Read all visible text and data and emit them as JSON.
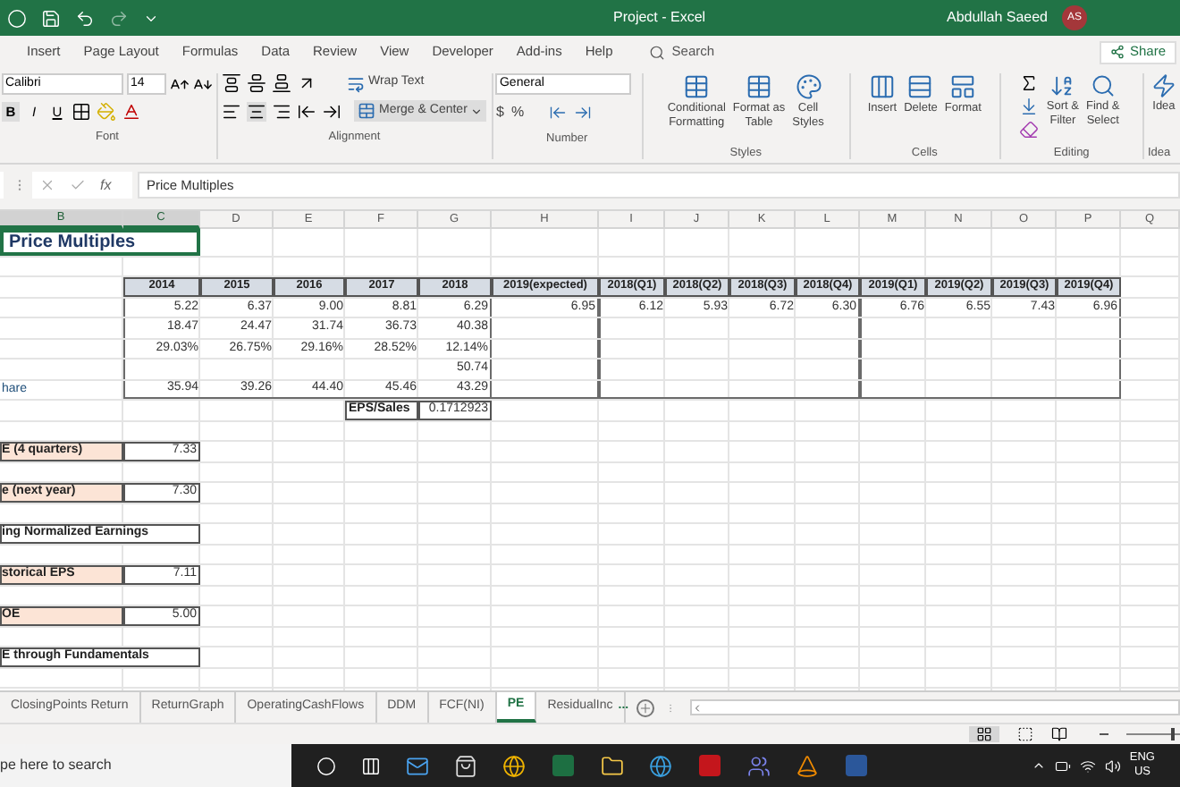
{
  "window": {
    "title": "Project - Excel",
    "user": "Abdullah Saeed",
    "avatar": "AS"
  },
  "menu_tabs": [
    {
      "label": "Insert",
      "selected": false
    },
    {
      "label": "Page Layout",
      "selected": false
    },
    {
      "label": "Formulas",
      "selected": false
    },
    {
      "label": "Data",
      "selected": false
    },
    {
      "label": "Review",
      "selected": false
    },
    {
      "label": "View",
      "selected": false
    },
    {
      "label": "Developer",
      "selected": false
    },
    {
      "label": "Add-ins",
      "selected": false
    },
    {
      "label": "Help",
      "selected": false
    }
  ],
  "search": {
    "placeholder": "Search"
  },
  "share": "Share",
  "ribbon": {
    "font": {
      "name": "Calibri",
      "size": "14",
      "style_buttons": [
        "B",
        "I",
        "U"
      ],
      "label": "Font"
    },
    "alignment": {
      "wrap": "Wrap Text",
      "merge": "Merge & Center",
      "label": "Alignment"
    },
    "number": {
      "format": "General",
      "symbols": [
        "$",
        "%"
      ],
      "label": "Number"
    },
    "styles": {
      "buttons": [
        {
          "lines": [
            "Conditional",
            "Formatting"
          ]
        },
        {
          "lines": [
            "Format as",
            "Table"
          ]
        },
        {
          "lines": [
            "Cell",
            "Styles"
          ]
        }
      ],
      "label": "Styles"
    },
    "cells": {
      "buttons": [
        "Insert",
        "Delete",
        "Format"
      ],
      "label": "Cells"
    },
    "editing": {
      "buttons": [
        {
          "lines": [
            "Sort &",
            "Filter"
          ]
        },
        {
          "lines": [
            "Find &",
            "Select"
          ]
        }
      ],
      "label": "Editing"
    },
    "ideas": {
      "button": "Idea",
      "label": "Idea"
    }
  },
  "formula_bar": {
    "fx": "fx",
    "content": "Price Multiples"
  },
  "sheet": {
    "columns": [
      {
        "letter": "B",
        "selected": true
      },
      {
        "letter": "C",
        "selected": true
      },
      {
        "letter": "D",
        "selected": false
      },
      {
        "letter": "E",
        "selected": false
      },
      {
        "letter": "F",
        "selected": false
      },
      {
        "letter": "G",
        "selected": false
      },
      {
        "letter": "H",
        "selected": false
      },
      {
        "letter": "I",
        "selected": false
      },
      {
        "letter": "J",
        "selected": false
      },
      {
        "letter": "K",
        "selected": false
      },
      {
        "letter": "L",
        "selected": false
      },
      {
        "letter": "M",
        "selected": false
      },
      {
        "letter": "N",
        "selected": false
      },
      {
        "letter": "O",
        "selected": false
      },
      {
        "letter": "P",
        "selected": false
      },
      {
        "letter": "Q",
        "selected": false
      }
    ],
    "rows": [
      {
        "kind": "title",
        "cells": {
          "B": "Price Multiples"
        }
      },
      {
        "kind": "blank"
      },
      {
        "kind": "header",
        "cells": {
          "C": "2014",
          "D": "2015",
          "E": "2016",
          "F": "2017",
          "G": "2018",
          "H": "2019(expected)",
          "I": "2018(Q1)",
          "J": "2018(Q2)",
          "K": "2018(Q3)",
          "L": "2018(Q4)",
          "M": "2019(Q1)",
          "N": "2019(Q2)",
          "O": "2019(Q3)",
          "P": "2019(Q4)"
        }
      },
      {
        "kind": "data",
        "cells": {
          "C": "5.22",
          "D": "6.37",
          "E": "9.00",
          "F": "8.81",
          "G": "6.29",
          "H": "6.95",
          "I": "6.12",
          "J": "5.93",
          "K": "6.72",
          "L": "6.30",
          "M": "6.76",
          "N": "6.55",
          "O": "7.43",
          "P": "6.96"
        }
      },
      {
        "kind": "data",
        "cells": {
          "C": "18.47",
          "D": "24.47",
          "E": "31.74",
          "F": "36.73",
          "G": "40.38"
        }
      },
      {
        "kind": "data",
        "cells": {
          "C": "29.03%",
          "D": "26.75%",
          "E": "29.16%",
          "F": "28.52%",
          "G": "12.14%"
        }
      },
      {
        "kind": "data",
        "cells": {
          "G": "50.74"
        }
      },
      {
        "kind": "data",
        "cells": {
          "B": "hare",
          "C": "35.94",
          "D": "39.26",
          "E": "44.40",
          "F": "45.46",
          "G": "43.29"
        }
      },
      {
        "kind": "note",
        "cells": {
          "F": "EPS/Sales",
          "G": "0.1712923"
        }
      },
      {
        "kind": "blank"
      },
      {
        "kind": "label",
        "cells": {
          "B": "E (4 quarters)",
          "C": "7.33"
        }
      },
      {
        "kind": "blank"
      },
      {
        "kind": "label",
        "cells": {
          "B": "e (next year)",
          "C": "7.30"
        }
      },
      {
        "kind": "blank"
      },
      {
        "kind": "section",
        "cells": {
          "B": "ing Normalized Earnings"
        }
      },
      {
        "kind": "blank"
      },
      {
        "kind": "label",
        "cells": {
          "B": "storical EPS",
          "C": "7.11"
        }
      },
      {
        "kind": "blank"
      },
      {
        "kind": "label",
        "cells": {
          "B": "OE",
          "C": "5.00"
        }
      },
      {
        "kind": "blank"
      },
      {
        "kind": "section",
        "cells": {
          "B": "E through Fundamentals"
        }
      },
      {
        "kind": "blank"
      }
    ]
  },
  "sheet_tabs": [
    {
      "label": "ClosingPoints Return",
      "selected": false
    },
    {
      "label": "ReturnGraph",
      "selected": false
    },
    {
      "label": "OperatingCashFlows",
      "selected": false
    },
    {
      "label": "DDM",
      "selected": false
    },
    {
      "label": "FCF(NI)",
      "selected": false
    },
    {
      "label": "PE",
      "selected": true
    },
    {
      "label": "ResidualInc",
      "selected": false
    }
  ],
  "more_tabs": "...",
  "status_bar": {
    "zoom": {
      "level": 0.9
    }
  },
  "taskbar": {
    "search_placeholder": "pe here to search",
    "language": "ENG",
    "region": "US"
  }
}
